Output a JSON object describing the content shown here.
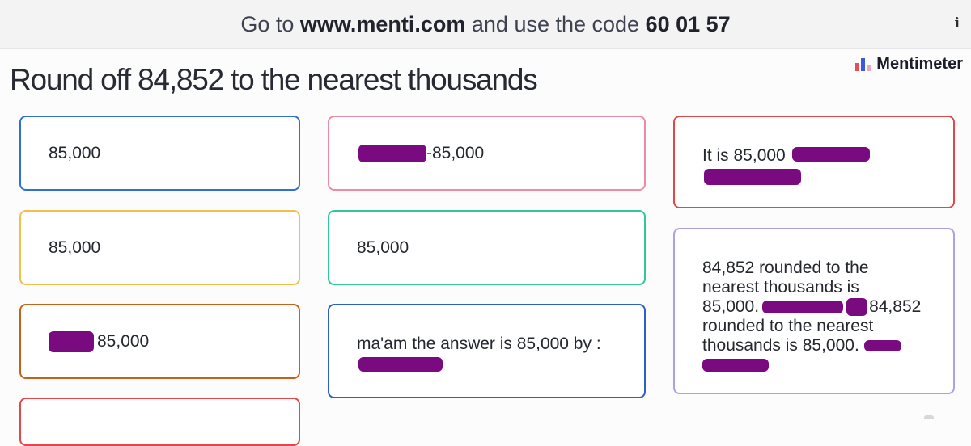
{
  "header": {
    "prefix": "Go to ",
    "url": "www.menti.com",
    "middle": " and use the code ",
    "code": "60 01 57",
    "info_icon": "info-icon"
  },
  "brand": {
    "name": "Mentimeter",
    "logo_icon": "mentimeter-bar-chart-logo"
  },
  "question": "Round off 84,852 to the nearest thousands",
  "colors": {
    "blue": "#2f6fd6",
    "yellow": "#f1c04a",
    "orange": "#c2621b",
    "red": "#e34848",
    "pink": "#f08aa2",
    "green": "#31c897",
    "navy": "#2b5fc9",
    "lavender": "#a9a2e3",
    "redaction": "#7a0a7f"
  },
  "responses": [
    {
      "id": "r1",
      "text": "85,000"
    },
    {
      "id": "r2",
      "text": "85,000"
    },
    {
      "id": "r3",
      "text": "85,000"
    },
    {
      "id": "r4",
      "text": "-85,000"
    },
    {
      "id": "r5",
      "text": "85,000"
    },
    {
      "id": "r6",
      "text": "ma'am the answer is 85,000 by :"
    },
    {
      "id": "r7",
      "text": "It is 85,000"
    },
    {
      "id": "r8_line1",
      "text": "84,852 rounded to the"
    },
    {
      "id": "r8_line2",
      "text": "nearest thousands is"
    },
    {
      "id": "r8_line3a",
      "text": "85,000."
    },
    {
      "id": "r8_line3b",
      "text": "84,852"
    },
    {
      "id": "r8_line4",
      "text": "rounded to the nearest"
    },
    {
      "id": "r8_line5",
      "text": "thousands is 85,000."
    }
  ]
}
